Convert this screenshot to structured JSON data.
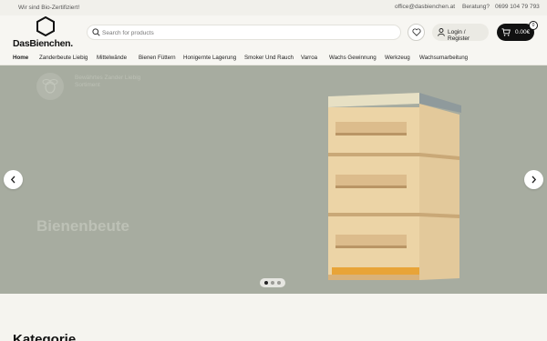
{
  "topbar": {
    "certified_text": "Wir sind Bio-Zertifiziert!",
    "email": "office@dasbienchen.at",
    "consult_label": "Beratung?",
    "phone": "0699 104 79 793"
  },
  "header": {
    "logo_text": "DasBienchen.",
    "search_placeholder": "Search for products",
    "login_label": "Login / Register",
    "cart_amount": "0.00€",
    "cart_count": "0"
  },
  "nav": {
    "items": [
      {
        "label": "Home"
      },
      {
        "label": "Zanderbeute Liebig"
      },
      {
        "label": "Mittelwände"
      },
      {
        "label": "Bienen Füttern"
      },
      {
        "label": "Honigernte Lagerung"
      },
      {
        "label": "Smoker Und Rauch"
      },
      {
        "label": "Varroa"
      },
      {
        "label": "Wachs Gewinnung"
      },
      {
        "label": "Werkzeug"
      },
      {
        "label": "Wachsumarbeitung"
      }
    ]
  },
  "hero": {
    "tagline": "Bewährtes Zander Liebig Sortiment",
    "heading": "Bienenbeute",
    "slides_total": 3,
    "active_slide": 1
  },
  "section": {
    "title": "Kategorie"
  },
  "colors": {
    "hero_bg": "#a7aca0",
    "topbar_bg": "#f1f0eb",
    "header_bg": "#f7f6f2",
    "cart_bg": "#111111"
  }
}
